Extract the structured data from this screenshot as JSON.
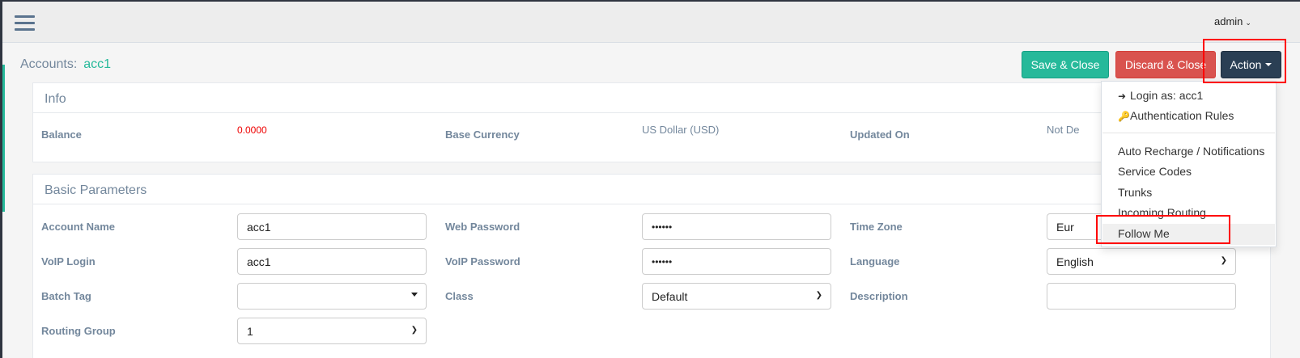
{
  "header": {
    "user_label": "admin"
  },
  "title": {
    "prefix": "Accounts:",
    "account": "acc1"
  },
  "buttons": {
    "save": "Save & Close",
    "discard": "Discard & Close",
    "action": "Action"
  },
  "info": {
    "title": "Info",
    "balance_label": "Balance",
    "balance_value": "0.0000",
    "currency_label": "Base Currency",
    "currency_value": "US Dollar (USD)",
    "updated_label": "Updated On",
    "updated_value": "Not De"
  },
  "basic": {
    "title": "Basic Parameters",
    "account_name_label": "Account Name",
    "account_name_value": "acc1",
    "web_password_label": "Web Password",
    "web_password_value": "••••••",
    "time_zone_label": "Time Zone",
    "time_zone_value": "Eur",
    "voip_login_label": "VoIP Login",
    "voip_login_value": "acc1",
    "voip_password_label": "VoIP Password",
    "voip_password_value": "••••••",
    "language_label": "Language",
    "language_value": "English",
    "batch_tag_label": "Batch Tag",
    "batch_tag_value": "",
    "class_label": "Class",
    "class_value": "Default",
    "description_label": "Description",
    "description_value": "",
    "routing_group_label": "Routing Group",
    "routing_group_value": "1"
  },
  "action_menu": {
    "login_as": "Login as: acc1",
    "auth_rules": "Authentication Rules",
    "auto_recharge": "Auto Recharge / Notifications",
    "service_codes": "Service Codes",
    "trunks": "Trunks",
    "incoming_routing": "Incoming Routing",
    "follow_me": "Follow Me"
  },
  "colors": {
    "accent_teal": "#26b99a",
    "danger": "#d9534f",
    "navy": "#2a3f54",
    "highlight": "#ff0000"
  }
}
